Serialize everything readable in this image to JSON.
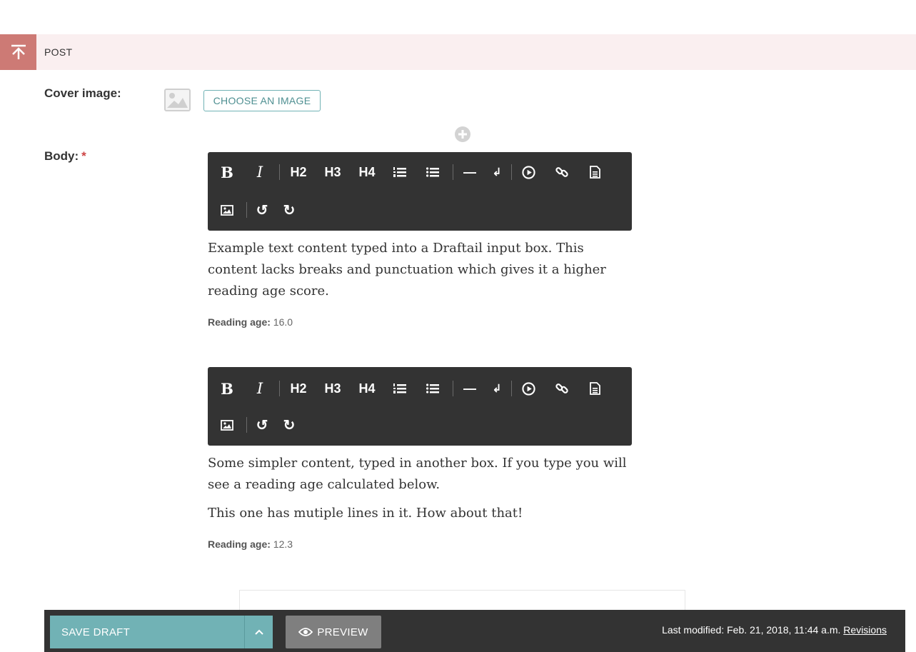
{
  "section": {
    "toggle_icon": "collapse-up-icon",
    "title": "POST"
  },
  "cover": {
    "label": "Cover image:",
    "placeholder_icon": "image-placeholder-icon",
    "choose_label": "CHOOSE AN IMAGE"
  },
  "add_block_icon": "plus-circle-icon",
  "body": {
    "label": "Body:",
    "required_mark": "*"
  },
  "toolbar": {
    "bold": "B",
    "italic": "I",
    "h2": "H2",
    "h3": "H3",
    "h4": "H4",
    "hr": "—",
    "line_break": "↲",
    "undo": "↺",
    "redo": "↻",
    "icons": [
      "ordered-list-icon",
      "unordered-list-icon",
      "embed-icon",
      "link-icon",
      "document-icon",
      "image-icon"
    ]
  },
  "editors": [
    {
      "paragraphs": [
        "Example text content typed into a Draftail input box. This content lacks breaks and punctuation which gives it a higher reading  age score."
      ],
      "reading_age_label": "Reading age:",
      "reading_age_value": "16.0"
    },
    {
      "paragraphs": [
        "Some simpler content, typed in another box. If you type you will see a reading age calculated below.",
        "This one has mutiple lines in it. How about that!"
      ],
      "reading_age_label": "Reading age:",
      "reading_age_value": "12.3"
    }
  ],
  "footer": {
    "save_label": "SAVE DRAFT",
    "save_toggle_icon": "chevron-up-icon",
    "preview_label": "PREVIEW",
    "preview_icon": "eye-icon",
    "last_modified": "Last modified: Feb. 21, 2018, 11:44 a.m.",
    "revisions_label": "Revisions"
  },
  "colors": {
    "section_bar": "#faeff0",
    "section_toggle": "#cd7a75",
    "teal": "#71b2b5",
    "dark": "#333333",
    "required": "#cd4444"
  }
}
